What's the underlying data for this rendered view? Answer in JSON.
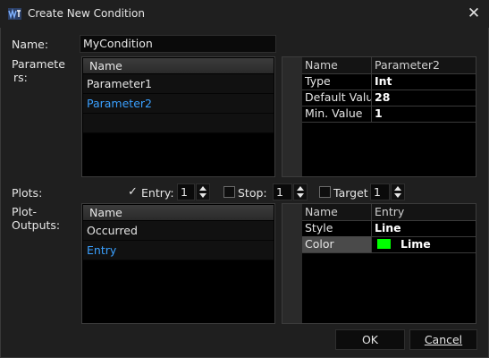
{
  "window": {
    "title": "Create New Condition",
    "close_symbol": "✕"
  },
  "name_field": {
    "label": "Name:",
    "value": "MyCondition"
  },
  "parameters": {
    "label_line1": "Paramete",
    "label_line2": "rs:",
    "list_header": "Name",
    "items": [
      "Parameter1",
      "Parameter2"
    ],
    "selected_index": 1,
    "properties": {
      "header_key": "Name",
      "header_value": "Parameter2",
      "rows": [
        {
          "key": "Type",
          "value": "Int"
        },
        {
          "key": "Default Valu",
          "value": "28"
        },
        {
          "key": "Min. Value",
          "value": "1"
        }
      ]
    }
  },
  "plots": {
    "label": "Plots:",
    "entry": {
      "label": "Entry:",
      "value": "1",
      "checked": true
    },
    "stop": {
      "label": "Stop:",
      "value": "1",
      "checked": false
    },
    "target": {
      "label": "Target",
      "value": "1",
      "checked": false
    }
  },
  "plot_outputs": {
    "label_line1": "Plot-",
    "label_line2": "Outputs:",
    "list_header": "Name",
    "items": [
      "Occurred",
      "Entry"
    ],
    "selected_index": 1,
    "properties": {
      "header_key": "Name",
      "header_value": "Entry",
      "rows": [
        {
          "key": "Style",
          "value": "Line"
        },
        {
          "key": "Color",
          "value": "Lime",
          "swatch": "#00ff00"
        }
      ]
    }
  },
  "buttons": {
    "ok": "OK",
    "cancel": "Cancel"
  },
  "colors": {
    "background": "#1f1f1f",
    "selected_text": "#3aa0ff",
    "lime": "#00ff00"
  }
}
